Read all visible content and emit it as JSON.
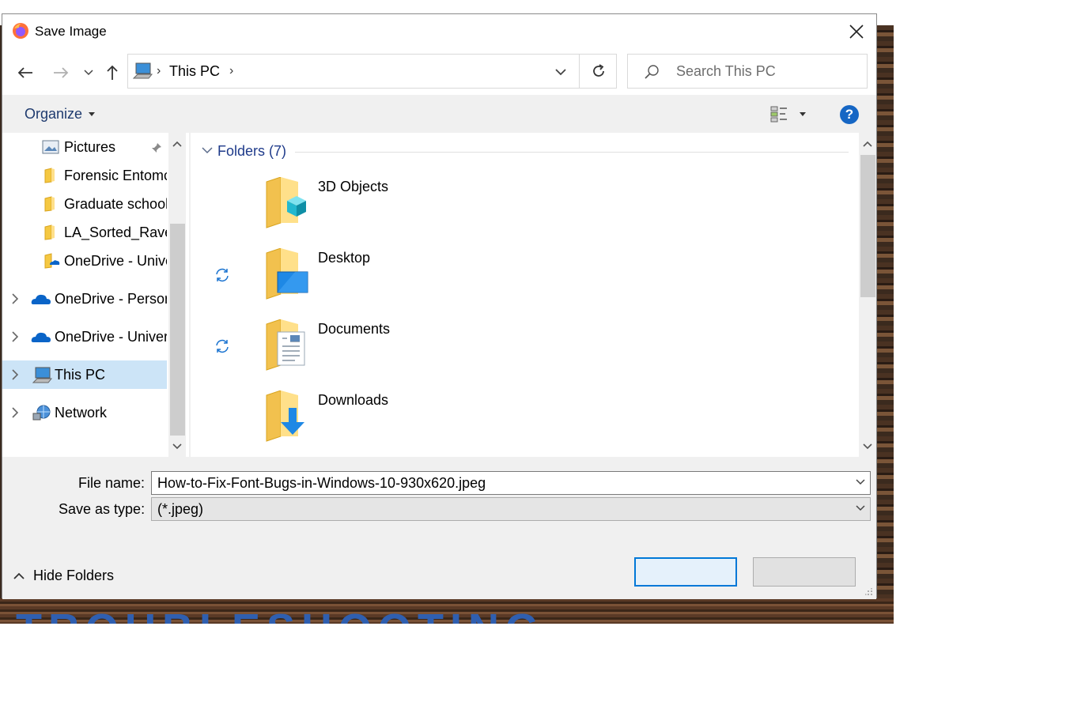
{
  "dialog": {
    "title": "Save Image",
    "app_icon": "firefox-icon",
    "close_icon": "close-icon"
  },
  "nav": {
    "back_icon": "back-arrow-icon",
    "forward_icon": "forward-arrow-icon",
    "recent_icon": "chevron-down-icon",
    "up_icon": "up-arrow-icon"
  },
  "address": {
    "location": "This PC",
    "refresh_icon": "refresh-icon"
  },
  "search": {
    "placeholder": "Search This PC"
  },
  "toolbar": {
    "organize_label": "Organize",
    "view_icon": "change-view-icon",
    "help_label": "?"
  },
  "sidebar": {
    "items": [
      {
        "label": "Pictures",
        "icon": "pictures-icon",
        "pinned": true
      },
      {
        "label": "Forensic Entomc",
        "icon": "folder-icon"
      },
      {
        "label": "Graduate school",
        "icon": "folder-icon"
      },
      {
        "label": "LA_Sorted_Rave",
        "icon": "folder-icon"
      },
      {
        "label": "OneDrive - Unive",
        "icon": "onedrive-folder-icon"
      },
      {
        "label": "OneDrive - Persor",
        "icon": "onedrive-cloud-icon"
      },
      {
        "label": "OneDrive - Univer",
        "icon": "onedrive-cloud-icon"
      },
      {
        "label": "This PC",
        "icon": "computer-icon",
        "selected": true
      },
      {
        "label": "Network",
        "icon": "network-icon"
      }
    ]
  },
  "content": {
    "group_title": "Folders (7)",
    "folders": [
      {
        "label": "3D Objects",
        "icon": "3d-objects-folder-icon",
        "sync": false
      },
      {
        "label": "Desktop",
        "icon": "desktop-folder-icon",
        "sync": true
      },
      {
        "label": "Documents",
        "icon": "documents-folder-icon",
        "sync": true
      },
      {
        "label": "Downloads",
        "icon": "downloads-folder-icon",
        "sync": false
      }
    ]
  },
  "form": {
    "filename_label": "File name:",
    "filename_value": "How-to-Fix-Font-Bugs-in-Windows-10-930x620.jpeg",
    "type_label": "Save as type:",
    "type_value": "(*.jpeg)"
  },
  "footer": {
    "hide_folders_label": "Hide Folders",
    "save_label": "",
    "cancel_label": ""
  },
  "background": {
    "banner_text": "TROUBLESHOOTING"
  }
}
